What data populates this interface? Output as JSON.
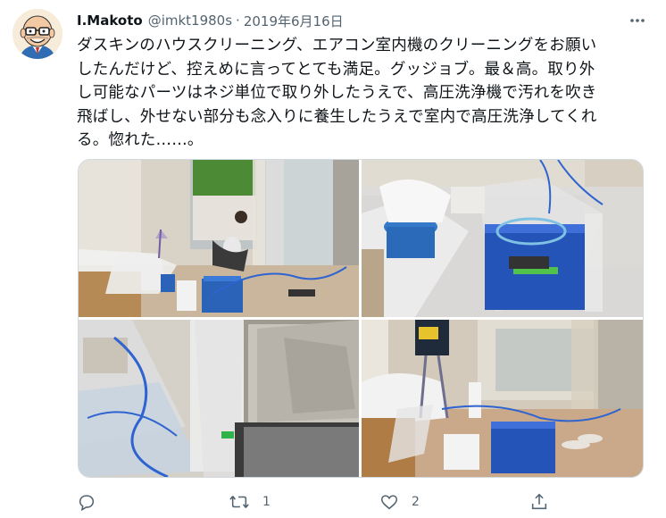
{
  "tweet": {
    "display_name": "I.Makoto",
    "handle": "@imkt1980s",
    "separator": "·",
    "date": "2019年6月16日",
    "text": "ダスキンのハウスクリーニング、エアコン室内機のクリーニングをお願い\nしたんだけど、控えめに言ってとても満足。グッジョブ。最＆高。取り外\nし可能なパーツはネジ単位で取り外したうえで、高圧洗浄機で汚れを吹き\n飛ばし、外せない部分も念入りに養生したうえで室内で高圧洗浄してくれ\nる。惚れた……。"
  },
  "actions": {
    "reply_count": "",
    "retweet_count": "1",
    "like_count": "2",
    "share_count": ""
  },
  "icons": {
    "avatar": "cartoon-bald-man-with-glasses-avatar",
    "more": "more-dots-icon",
    "reply": "reply-bubble-icon",
    "retweet": "retweet-arrows-icon",
    "like": "heart-icon",
    "share": "share-upload-icon"
  },
  "colors": {
    "text": "#0f1419",
    "secondary": "#536471",
    "border": "#cfd9de",
    "background": "#ffffff"
  }
}
